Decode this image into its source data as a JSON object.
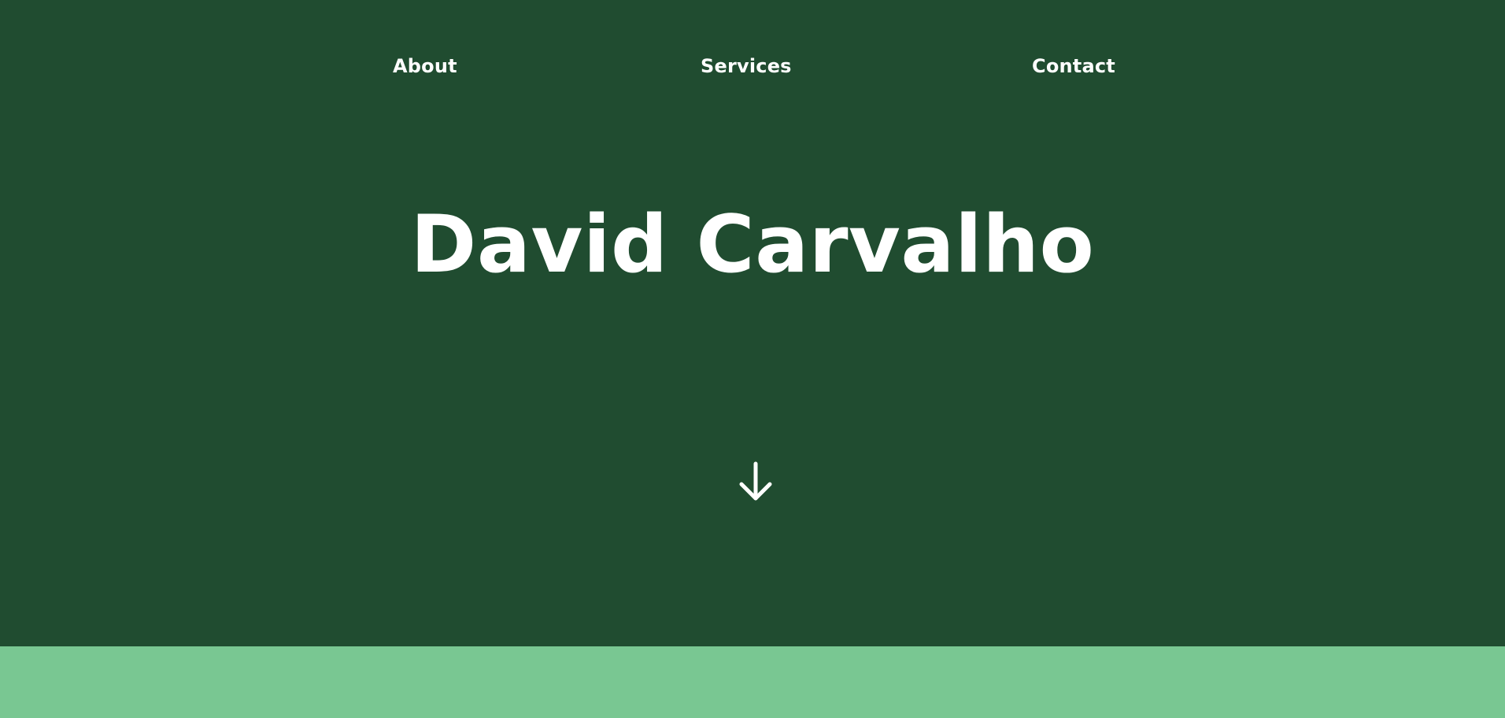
{
  "nav": {
    "items": [
      {
        "label": "About"
      },
      {
        "label": "Services"
      },
      {
        "label": "Contact"
      }
    ]
  },
  "hero": {
    "title": "David Carvalho",
    "scroll_icon": "arrow-down-icon"
  },
  "colors": {
    "hero_background": "#204c30",
    "band_background": "#79c792",
    "text": "#ffffff"
  }
}
